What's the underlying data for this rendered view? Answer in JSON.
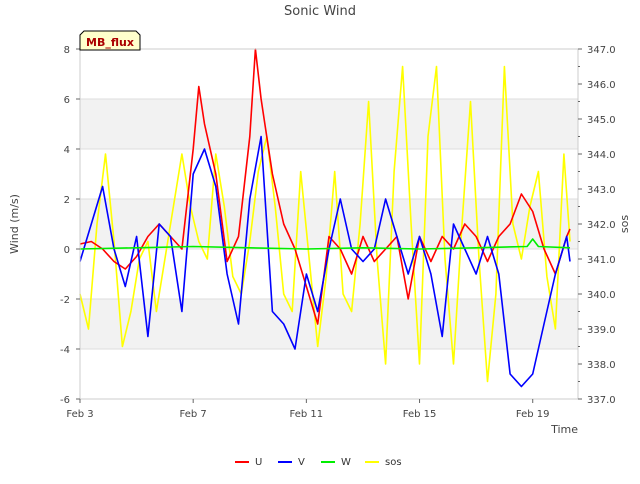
{
  "chart_data": {
    "type": "line",
    "title": "Sonic Wind",
    "xlabel": "Time",
    "ylabel": "Wind (m/s)",
    "y2label": "sos",
    "xlim": [
      3.0,
      20.6
    ],
    "ylim": [
      -6,
      8
    ],
    "y2lim": [
      337.0,
      347.0
    ],
    "x_ticks": [
      3,
      7,
      11,
      15,
      19
    ],
    "x_tick_labels": [
      "Feb 3",
      "Feb 7",
      "Feb 11",
      "Feb 15",
      "Feb 19"
    ],
    "y_ticks": [
      -6,
      -4,
      -2,
      0,
      2,
      4,
      6,
      8
    ],
    "y_tick_labels": [
      "-6",
      "-4",
      "-2",
      "0",
      "2",
      "4",
      "6",
      "8"
    ],
    "y2_ticks": [
      337,
      338,
      339,
      340,
      341,
      342,
      343,
      344,
      345,
      346,
      347
    ],
    "y2_tick_labels": [
      "337.0",
      "338.0",
      "339.0",
      "340.0",
      "341.0",
      "342.0",
      "343.0",
      "344.0",
      "345.0",
      "346.0",
      "347.0"
    ],
    "shaded_bands": [
      [
        -4,
        -2
      ],
      [
        0,
        2
      ],
      [
        4,
        6
      ]
    ],
    "grid": true,
    "legend_position": "bottom",
    "annotation": "MB_flux",
    "series": [
      {
        "name": "U",
        "axis": "left",
        "color": "#ff0000",
        "x": [
          3.0,
          3.4,
          3.8,
          4.2,
          4.6,
          5.0,
          5.4,
          5.8,
          6.2,
          6.6,
          7.0,
          7.2,
          7.4,
          7.8,
          8.2,
          8.6,
          9.0,
          9.2,
          9.4,
          9.8,
          10.2,
          10.6,
          11.0,
          11.4,
          11.8,
          12.2,
          12.6,
          13.0,
          13.4,
          13.8,
          14.2,
          14.6,
          15.0,
          15.4,
          15.8,
          16.2,
          16.6,
          17.0,
          17.4,
          17.8,
          18.2,
          18.6,
          19.0,
          19.4,
          19.8,
          20.2,
          20.4
        ],
        "y": [
          0.2,
          0.3,
          0.0,
          -0.5,
          -0.8,
          -0.3,
          0.5,
          1.0,
          0.5,
          0.0,
          4.0,
          6.5,
          5.0,
          3.0,
          -0.5,
          0.5,
          4.5,
          8.0,
          6.0,
          3.0,
          1.0,
          0.0,
          -1.5,
          -3.0,
          0.5,
          0.0,
          -1.0,
          0.5,
          -0.5,
          0.0,
          0.5,
          -2.0,
          0.5,
          -0.5,
          0.5,
          0.0,
          1.0,
          0.5,
          -0.5,
          0.5,
          1.0,
          2.2,
          1.5,
          0.0,
          -1.0,
          0.5,
          0.8
        ]
      },
      {
        "name": "V",
        "axis": "left",
        "color": "#0000ff",
        "x": [
          3.0,
          3.4,
          3.8,
          4.2,
          4.6,
          5.0,
          5.4,
          5.8,
          6.2,
          6.6,
          7.0,
          7.4,
          7.8,
          8.2,
          8.6,
          9.0,
          9.4,
          9.8,
          10.2,
          10.6,
          11.0,
          11.4,
          11.8,
          12.2,
          12.6,
          13.0,
          13.4,
          13.8,
          14.2,
          14.6,
          15.0,
          15.4,
          15.8,
          16.2,
          16.6,
          17.0,
          17.4,
          17.8,
          18.2,
          18.6,
          19.0,
          19.4,
          19.8,
          20.2,
          20.4
        ],
        "y": [
          -0.5,
          1.0,
          2.5,
          0.0,
          -1.5,
          0.5,
          -3.5,
          1.0,
          0.5,
          -2.5,
          3.0,
          4.0,
          2.5,
          -1.0,
          -3.0,
          2.0,
          4.5,
          -2.5,
          -3.0,
          -4.0,
          -1.0,
          -2.5,
          0.0,
          2.0,
          0.0,
          -0.5,
          0.0,
          2.0,
          0.5,
          -1.0,
          0.5,
          -1.0,
          -3.5,
          1.0,
          0.0,
          -1.0,
          0.5,
          -1.0,
          -5.0,
          -5.5,
          -5.0,
          -3.0,
          -1.0,
          0.5,
          -0.5
        ]
      },
      {
        "name": "W",
        "axis": "left",
        "color": "#00ee00",
        "x": [
          3.0,
          5.0,
          7.0,
          9.0,
          11.0,
          13.0,
          15.0,
          17.0,
          18.8,
          19.0,
          19.2,
          21.0
        ],
        "y": [
          0.0,
          0.05,
          0.1,
          0.05,
          0.0,
          0.05,
          0.0,
          0.05,
          0.1,
          0.4,
          0.1,
          0.05
        ]
      },
      {
        "name": "sos",
        "axis": "right",
        "color": "#ffff00",
        "x": [
          3.0,
          3.3,
          3.6,
          3.9,
          4.2,
          4.5,
          4.8,
          5.1,
          5.4,
          5.7,
          6.0,
          6.3,
          6.6,
          6.9,
          7.2,
          7.5,
          7.8,
          8.1,
          8.4,
          8.7,
          9.0,
          9.3,
          9.6,
          9.9,
          10.2,
          10.5,
          10.8,
          11.1,
          11.4,
          11.7,
          12.0,
          12.3,
          12.6,
          12.9,
          13.2,
          13.5,
          13.8,
          14.1,
          14.4,
          14.7,
          15.0,
          15.3,
          15.6,
          15.9,
          16.2,
          16.5,
          16.8,
          17.1,
          17.4,
          17.7,
          18.0,
          18.3,
          18.6,
          18.9,
          19.2,
          19.5,
          19.8,
          20.1,
          20.4
        ],
        "y": [
          340.0,
          339.0,
          342.0,
          344.0,
          341.5,
          338.5,
          339.5,
          341.0,
          341.5,
          339.5,
          341.0,
          342.5,
          344.0,
          342.5,
          341.5,
          341.0,
          344.0,
          342.5,
          340.5,
          340.0,
          341.5,
          343.5,
          344.5,
          342.5,
          340.0,
          339.5,
          343.5,
          341.0,
          338.5,
          340.5,
          343.5,
          340.0,
          339.5,
          342.0,
          345.5,
          341.0,
          338.0,
          343.5,
          346.5,
          342.0,
          338.0,
          344.5,
          346.5,
          341.0,
          338.0,
          342.0,
          345.5,
          341.0,
          337.5,
          340.0,
          346.5,
          342.0,
          341.0,
          342.5,
          343.5,
          340.5,
          339.0,
          344.0,
          341.5
        ]
      }
    ]
  }
}
